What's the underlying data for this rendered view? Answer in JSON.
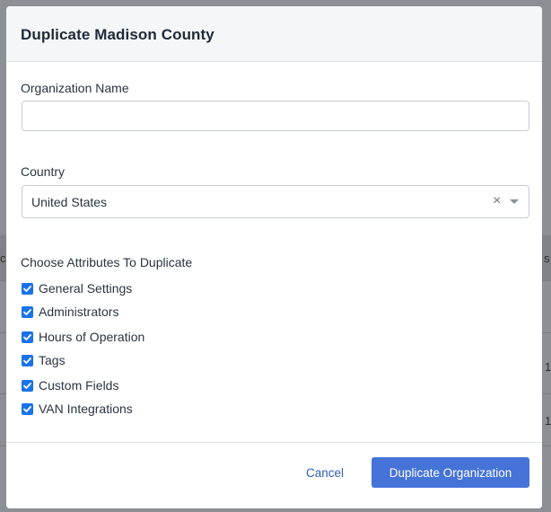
{
  "modal": {
    "title": "Duplicate Madison County"
  },
  "form": {
    "organization_name": {
      "label": "Organization Name",
      "value": "",
      "placeholder": ""
    },
    "country": {
      "label": "Country",
      "selected": "United States",
      "clear_glyph": "×"
    },
    "attributes": {
      "label": "Choose Attributes To Duplicate",
      "items": [
        {
          "label": "General Settings",
          "checked": true
        },
        {
          "label": "Administrators",
          "checked": true
        },
        {
          "label": "Hours of Operation",
          "checked": true
        },
        {
          "label": "Tags",
          "checked": true
        },
        {
          "label": "Custom Fields",
          "checked": true
        },
        {
          "label": "VAN Integrations",
          "checked": true
        }
      ]
    }
  },
  "footer": {
    "cancel_label": "Cancel",
    "submit_label": "Duplicate Organization"
  },
  "background": {
    "fragments": [
      "cr",
      "s",
      "1",
      "1"
    ]
  },
  "colors": {
    "accent": "#4573d8",
    "checkbox": "#1a73e8",
    "link": "#2f5fb3"
  }
}
